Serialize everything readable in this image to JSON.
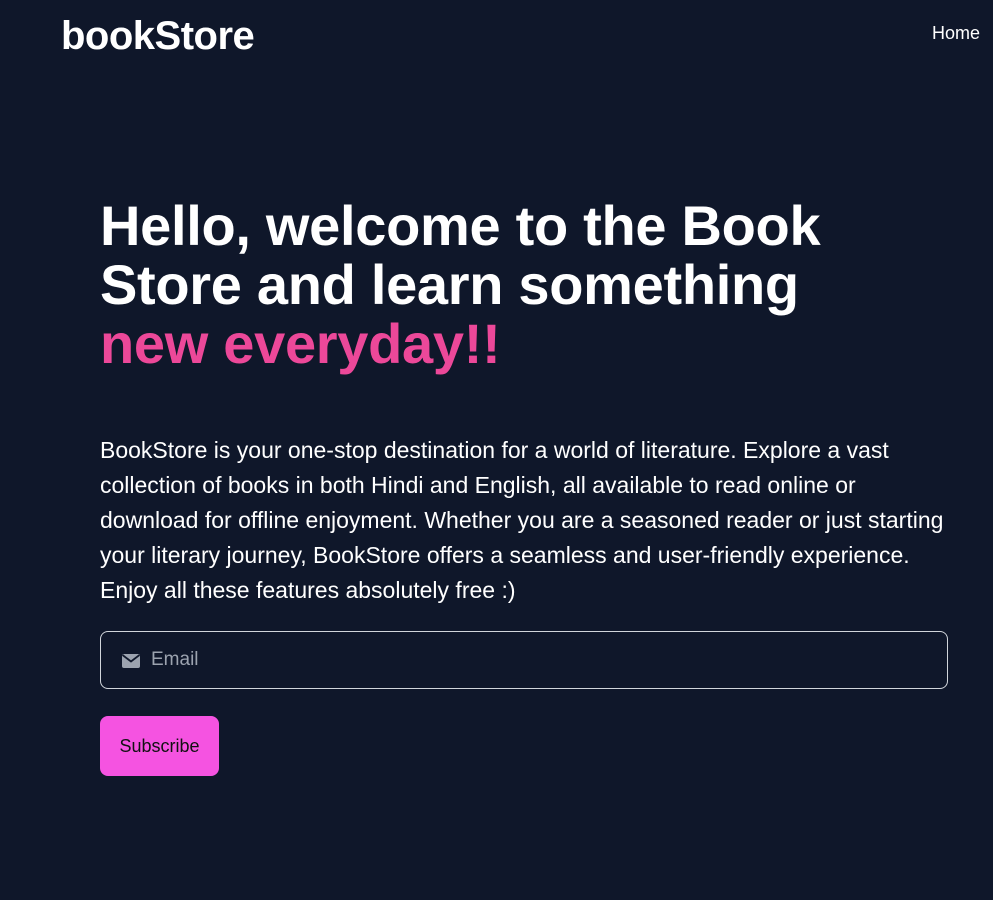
{
  "navbar": {
    "logo": "bookStore",
    "links": [
      {
        "label": "Home"
      }
    ]
  },
  "hero": {
    "headline_line1": "Hello, welcome to the Book",
    "headline_line2": "Store and learn something",
    "headline_accent": "new everyday!!",
    "description": "BookStore is your one-stop destination for a world of literature. Explore a vast collection of books in both Hindi and English, all available to read online or download for offline enjoyment. Whether you are a seasoned reader or just starting your literary journey, BookStore offers a seamless and user-friendly experience. Enjoy all these features absolutely free :)"
  },
  "subscribe_form": {
    "email_placeholder": "Email",
    "email_value": "",
    "email_icon": "envelope-icon",
    "button_label": "Subscribe"
  },
  "colors": {
    "background": "#0f172a",
    "accent_text": "#ec4899",
    "button_bg": "#f553e1",
    "text": "#ffffff"
  }
}
